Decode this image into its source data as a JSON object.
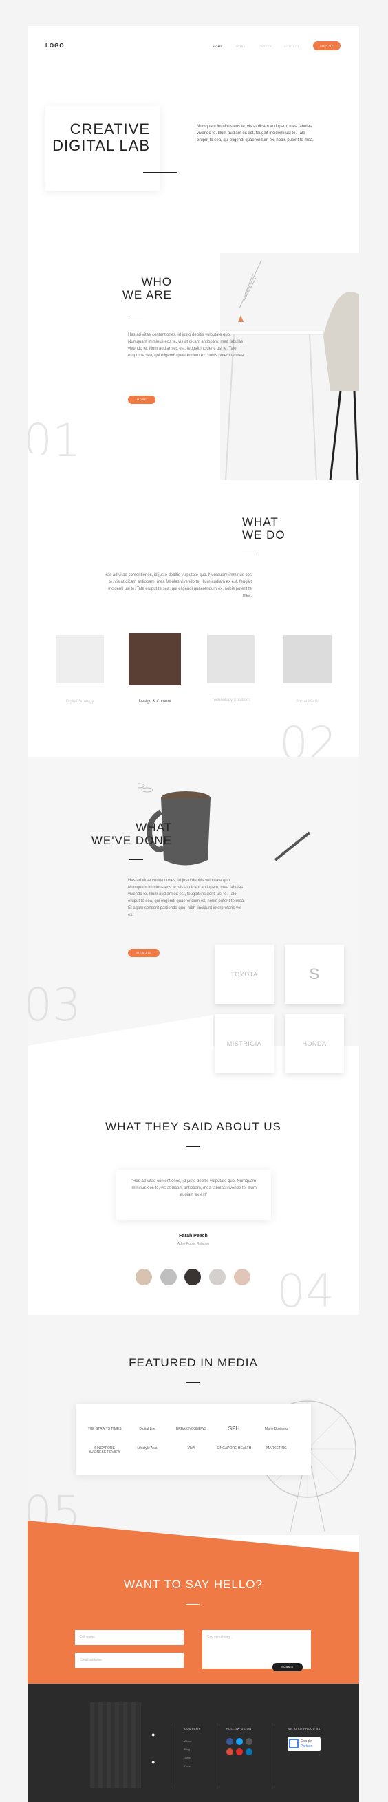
{
  "header": {
    "logo": "LOGO",
    "nav": [
      "HOME",
      "WORK",
      "CAREER",
      "CONTACT"
    ],
    "cta": "SIGN UP"
  },
  "hero": {
    "title_line1": "CREATIVE",
    "title_line2": "DIGITAL LAB",
    "text": "Numquam imminus eos te, vis at dicam antiopam, mea fabulas vivendo te. Illum audiam ex est, feugait incidenti usi te. Tale eruput te sea, qui eligendi quaerendum ex, nobis putent te mea."
  },
  "who": {
    "title_line1": "WHO",
    "title_line2": "WE ARE",
    "text": "Has ad vitae contentiones, id justo debitis vulputate quo. Numquam imminus eos te, vis at dicam antiopam, mea fabulas vivendo te. Illum audiam ex est, feugait incidenti usi te. Tale eruput te sea, qui eligendi quaerendum ex, nobis putent te mea.",
    "button": "MORE",
    "number": "01"
  },
  "what_we_do": {
    "title_line1": "WHAT",
    "title_line2": "WE DO",
    "text": "Has ad vitae contentiones, id justo debitis vulputate quo. Numquam imminus eos te, vis at dicam antiopam, mea fabulas vivendo te. Illum audiam ex est, feugait incidenti usi te. Tale eruput te sea, qui eligendi quaerendum ex, nobis putent te mea.",
    "services": [
      {
        "label": "Digital Strategy"
      },
      {
        "label": "Design & Content"
      },
      {
        "label": "Technology Solutions"
      },
      {
        "label": "Social Media"
      }
    ],
    "number": "02"
  },
  "done": {
    "title_line1": "WHAT",
    "title_line2": "WE'VE DONE",
    "text": "Has ad vitae contentiones, id justo debitis vulputate quo. Numquam imminus eos te, vis at dicam antiopam, mea fabulas vivendo te. Illum audiam ex est, feugait incidenti usi te. Tale eruput te sea, qui eligendi quaerendum ex, nobis putent te mea. Et agam senserit partiendo quo, nibh tincidunt interpretaris vel ex.",
    "button": "VIEW ALL",
    "clients": [
      "TOYOTA",
      "S",
      "MISTRIGIA",
      "HONDA"
    ],
    "number": "03"
  },
  "testimonials": {
    "title": "WHAT THEY SAID ABOUT US",
    "quote": "\"Has ad vitae contentiones, id justo debitis vulputate quo. Numquam imminus eos te, vis at dicam antiopam, mea fabulas vivendo te. Illum audiam ex est\"",
    "author": "Farah Peach",
    "role": "Adoe Public Relation",
    "number": "04"
  },
  "media": {
    "title": "FEATURED IN MEDIA",
    "logos_row1": [
      "THE STRAITS TIMES",
      "Digital Life",
      "BREAKINGSNEWS",
      "SPH",
      "Marie Business"
    ],
    "logos_row2": [
      "SINGAPORE BUSINESS REVIEW",
      "Lifestyle Asia",
      "VIVA",
      "SINGAPORE HEALTH",
      "MARKETING"
    ],
    "number": "05"
  },
  "contact": {
    "title": "WANT TO SAY HELLO?",
    "name_placeholder": "Full name",
    "email_placeholder": "Email address",
    "message_placeholder": "Say something...",
    "submit": "SUBMIT"
  },
  "footer": {
    "company_heading": "COMPANY",
    "company_links": [
      "About",
      "Blog",
      "Jobs",
      "Press"
    ],
    "follow_heading": "FOLLOW US ON",
    "proud_heading": "WE ALSO PROUD AS",
    "badge_line1": "Google",
    "badge_line2": "Partner"
  },
  "colors": {
    "accent": "#f07a45",
    "dark": "#2b2b2b"
  }
}
